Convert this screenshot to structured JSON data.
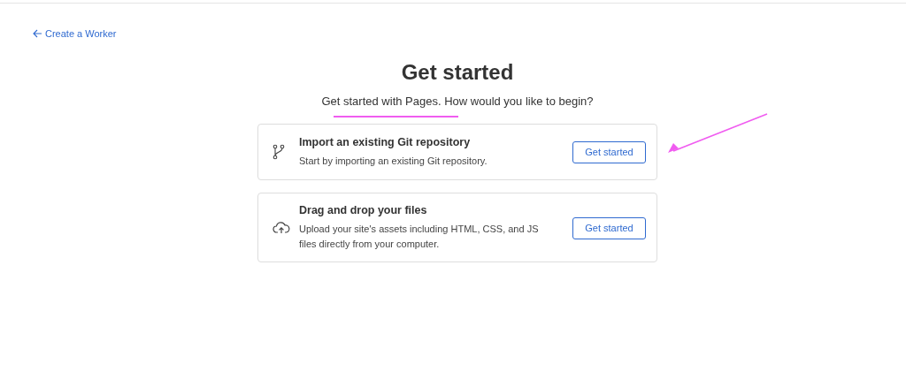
{
  "back_link": {
    "label": "Create a Worker"
  },
  "title": "Get started",
  "subtitle": "Get started with Pages. How would you like to begin?",
  "options": [
    {
      "kind": "git",
      "title": "Import an existing Git repository",
      "description": "Start by importing an existing Git repository.",
      "button": "Get started"
    },
    {
      "kind": "upload",
      "title": "Drag and drop your files",
      "description": "Upload your site's assets including HTML, CSS, and JS files directly from your computer.",
      "button": "Get started"
    }
  ]
}
